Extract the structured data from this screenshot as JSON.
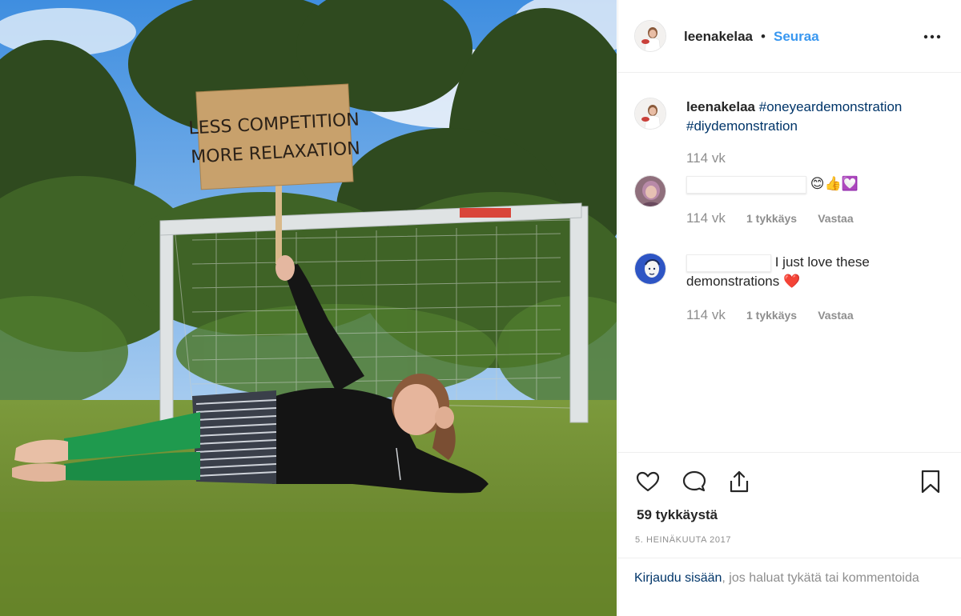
{
  "post": {
    "username": "leenakelaa",
    "separator": "•",
    "follow_label": "Seuraa",
    "more_icon": "more-horizontal-icon",
    "photo_sign_text": [
      "LESS COMPETITION",
      "MORE RELAXATION"
    ]
  },
  "comments": [
    {
      "username": "leenakelaa",
      "hashtag_1": "#oneyeardemonstration",
      "hashtag_2": "#diydemonstration",
      "timestamp": "114 vk"
    },
    {
      "emoji": "😊👍💟",
      "timestamp": "114 vk",
      "likes": "1 tykkäys",
      "reply_label": "Vastaa"
    },
    {
      "text_line_1": "I just love these",
      "text_line_2": "demonstrations",
      "emoji": "❤️",
      "timestamp": "114 vk",
      "likes": "1 tykkäys",
      "reply_label": "Vastaa"
    }
  ],
  "actions": {
    "like_icon": "heart-icon",
    "comment_icon": "comment-icon",
    "share_icon": "share-icon",
    "save_icon": "bookmark-icon",
    "likes_count": "59 tykkäystä",
    "date": "5. HEINÄKUUTA 2017"
  },
  "login": {
    "link_text": "Kirjaudu sisään",
    "rest_text": ", jos haluat tykätä tai kommentoida"
  },
  "colors": {
    "link_blue": "#3897f0",
    "hashtag_blue": "#003569",
    "meta_gray": "#8e8e8e",
    "heart_red": "#ed4956"
  }
}
